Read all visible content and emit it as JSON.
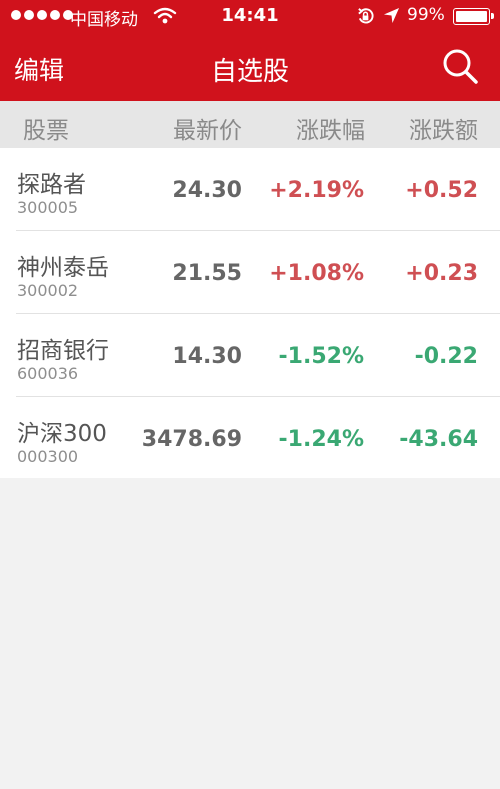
{
  "status_bar": {
    "carrier": "中国移动",
    "time": "14:41",
    "battery": "99%",
    "battery_level": 0.99,
    "icons": [
      "signal-dots-icon",
      "wifi-icon",
      "rotation-lock-icon",
      "location-arrow-icon",
      "battery-icon"
    ]
  },
  "nav": {
    "edit_label": "编辑",
    "title": "自选股",
    "search_icon": "search-icon"
  },
  "columns": {
    "stock": "股票",
    "price": "最新价",
    "pct": "涨跌幅",
    "chg": "涨跌额"
  },
  "colors": {
    "brand_red": "#d0121c",
    "up": "#cf4f53",
    "down": "#3aa873"
  },
  "stocks": [
    {
      "name": "探路者",
      "code": "300005",
      "price": "24.30",
      "pct": "+2.19%",
      "chg": "+0.52",
      "trend": "up"
    },
    {
      "name": "神州泰岳",
      "code": "300002",
      "price": "21.55",
      "pct": "+1.08%",
      "chg": "+0.23",
      "trend": "up"
    },
    {
      "name": "招商银行",
      "code": "600036",
      "price": "14.30",
      "pct": "-1.52%",
      "chg": "-0.22",
      "trend": "down"
    },
    {
      "name": "沪深300",
      "code": "000300",
      "price": "3478.69",
      "pct": "-1.24%",
      "chg": "-43.64",
      "trend": "down"
    }
  ]
}
